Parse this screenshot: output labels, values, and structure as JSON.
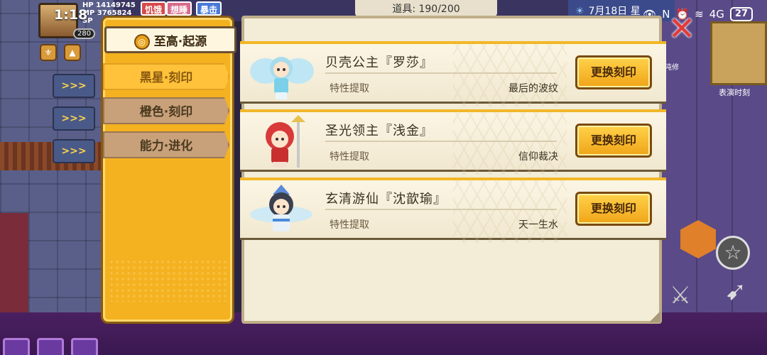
{
  "status_bar": {
    "time": "1:18",
    "battery": "27",
    "indicators": "4G"
  },
  "hud": {
    "hp": "HP 14149745",
    "mp": "MP 3765824",
    "sp": "SP",
    "level": "280",
    "tags": [
      "饥饿",
      "想睡",
      "暴击"
    ],
    "items_counter": "道具:  190/200",
    "date": "7月18日 星",
    "performance_label": "表演时刻",
    "chaos_label": "混沌修",
    "side_buttons": [
      ">>>",
      ">>>",
      ">>>"
    ]
  },
  "tabs": [
    {
      "label": "至高·起源",
      "active": true
    },
    {
      "label": "黑星·刻印"
    },
    {
      "label": "橙色·刻印"
    },
    {
      "label": "能力·进化"
    }
  ],
  "cards": [
    {
      "name": "贝壳公主『罗莎』",
      "trait_label": "特性提取",
      "trait_value": "最后的波纹",
      "button": "更换刻印",
      "accent": "#7ad0e8"
    },
    {
      "name": "圣光领主『浅金』",
      "trait_label": "特性提取",
      "trait_value": "信仰裁决",
      "button": "更换刻印",
      "accent": "#d83a3a"
    },
    {
      "name": "玄清游仙『沈歆瑜』",
      "trait_label": "特性提取",
      "trait_value": "天一生水",
      "button": "更换刻印",
      "accent": "#4a5a7a"
    }
  ],
  "icons": {
    "close": "close-icon",
    "star": "star-icon",
    "sword": "sword-icon",
    "bow": "bow-icon"
  }
}
